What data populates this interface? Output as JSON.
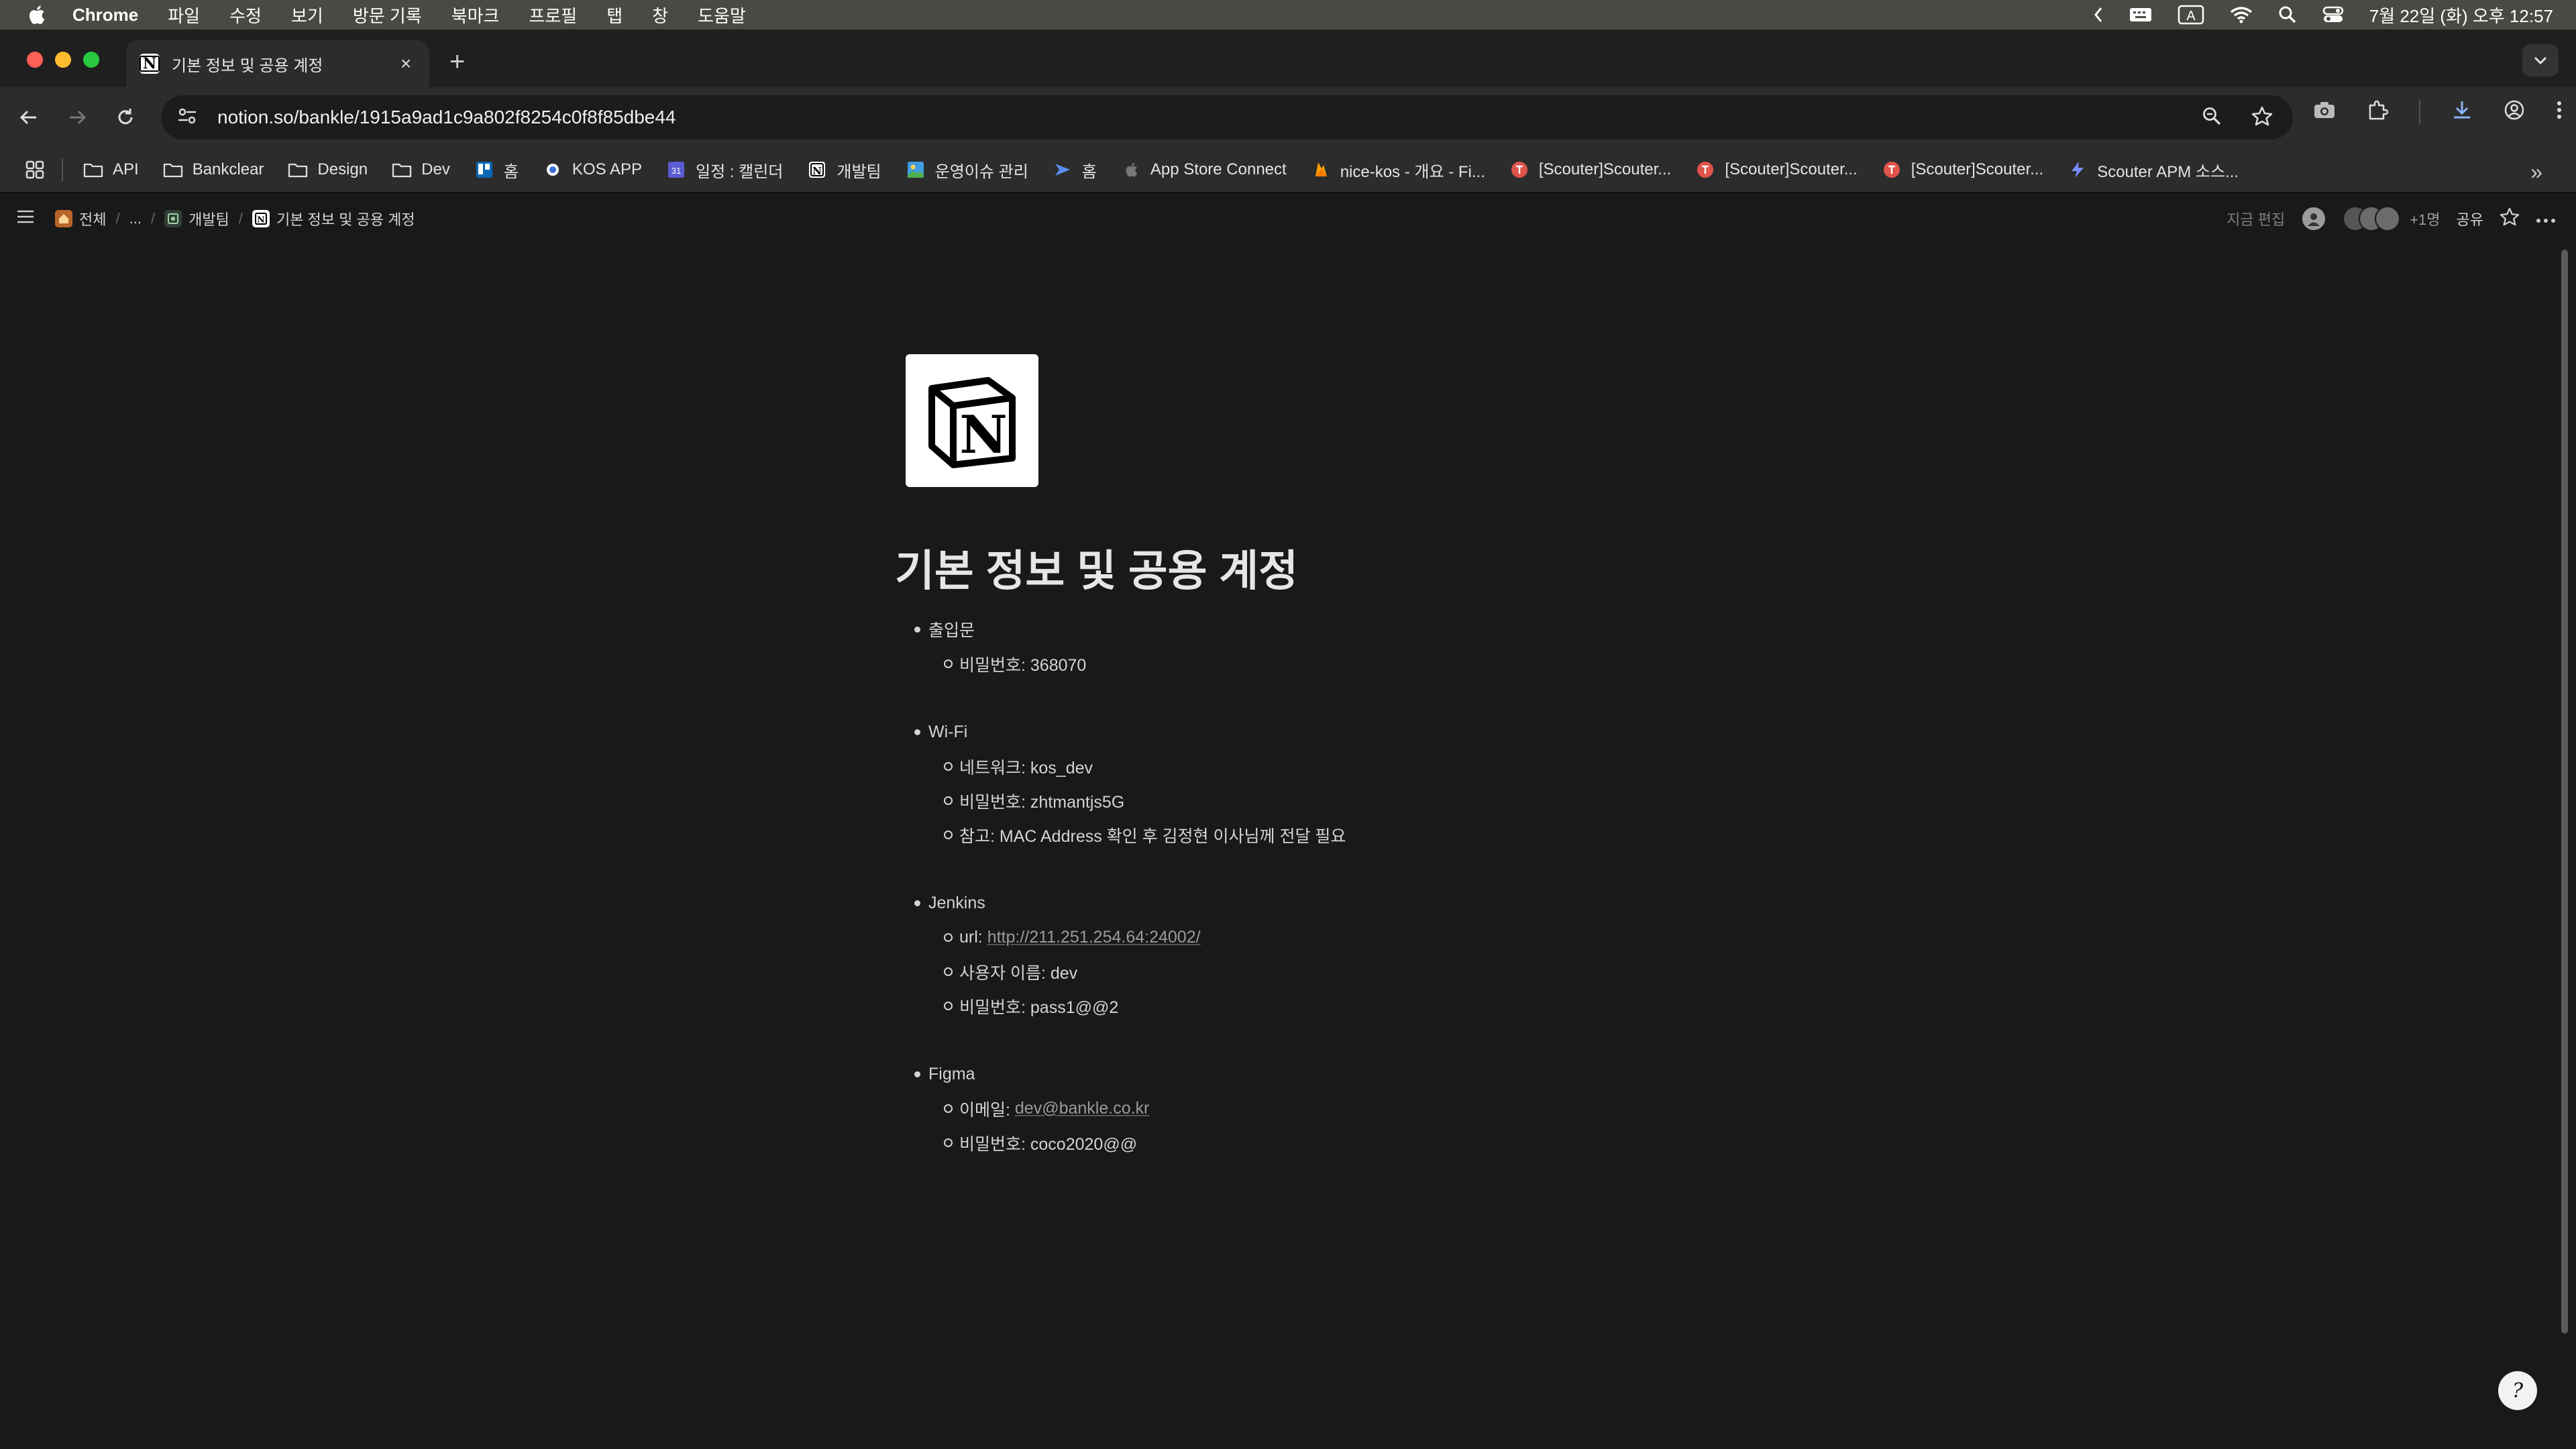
{
  "menubar": {
    "app": "Chrome",
    "items": [
      "파일",
      "수정",
      "보기",
      "방문 기록",
      "북마크",
      "프로필",
      "탭",
      "창",
      "도움말"
    ],
    "input_indicator": "A",
    "datetime": "7월 22일 (화) 오후 12:57"
  },
  "tab": {
    "title": "기본 정보 및 공용 계정"
  },
  "address": {
    "url": "notion.so/bankle/1915a9ad1c9a802f8254c0f8f85dbe44"
  },
  "bookmarks": [
    {
      "label": "API",
      "icon": "folder-icon"
    },
    {
      "label": "Bankclear",
      "icon": "folder-icon"
    },
    {
      "label": "Design",
      "icon": "folder-icon"
    },
    {
      "label": "Dev",
      "icon": "folder-icon"
    },
    {
      "label": "홈",
      "icon": "board-icon"
    },
    {
      "label": "KOS APP",
      "icon": "app-icon"
    },
    {
      "label": "일정 : 캘린더",
      "icon": "calendar-icon"
    },
    {
      "label": "개발팀",
      "icon": "notion-icon"
    },
    {
      "label": "운영이슈 관리",
      "icon": "image-icon"
    },
    {
      "label": "홈",
      "icon": "arrow-icon"
    },
    {
      "label": "App Store Connect",
      "icon": "apple-icon"
    },
    {
      "label": "nice-kos - 개요 - Fi...",
      "icon": "fire-icon"
    },
    {
      "label": "[Scouter]Scouter...",
      "icon": "scouter-icon"
    },
    {
      "label": "[Scouter]Scouter...",
      "icon": "scouter-icon"
    },
    {
      "label": "[Scouter]Scouter...",
      "icon": "scouter-icon"
    },
    {
      "label": "Scouter APM 소스...",
      "icon": "bolt-icon"
    }
  ],
  "breadcrumb": {
    "root": "전체",
    "ellipsis": "...",
    "parent": "개발팀",
    "current": "기본 정보 및 공용 계정"
  },
  "topbar": {
    "edit_status": "지금 편집",
    "extra_viewers": "+1명",
    "share": "공유"
  },
  "page": {
    "title": "기본 정보 및 공용 계정",
    "sections": [
      {
        "heading": "출입문",
        "items": [
          {
            "text": "비밀번호: 368070"
          }
        ]
      },
      {
        "heading": "Wi-Fi",
        "items": [
          {
            "text": "네트워크: kos_dev"
          },
          {
            "text": "비밀번호: zhtmantjs5G"
          },
          {
            "text": "참고: MAC Address 확인 후 김정현 이사님께 전달 필요"
          }
        ]
      },
      {
        "heading": "Jenkins",
        "items": [
          {
            "prefix": "url: ",
            "link": "http://211.251.254.64:24002/"
          },
          {
            "text": "사용자 이름: dev"
          },
          {
            "text": "비밀번호: pass1@@2"
          }
        ]
      },
      {
        "heading": "Figma",
        "items": [
          {
            "prefix": "이메일: ",
            "link": "dev@bankle.co.kr"
          },
          {
            "text": "비밀번호: coco2020@@"
          }
        ]
      }
    ]
  },
  "colors": {
    "background": "#191919",
    "text": "#d4d4d4",
    "link": "#9b9b9b",
    "traffic_red": "#fe5f57",
    "traffic_yellow": "#febc2e",
    "traffic_green": "#28c840"
  }
}
